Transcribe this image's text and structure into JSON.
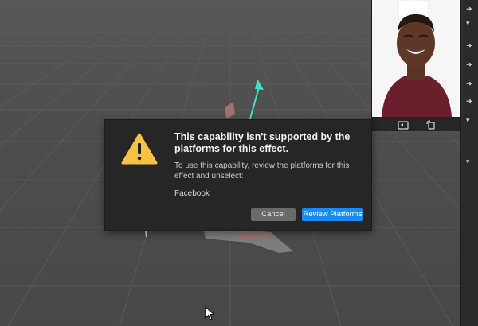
{
  "dialog": {
    "title": "This capability isn't supported by the platforms for this effect.",
    "message": "To use this capability, review the platforms for this effect and unselect:",
    "platform": "Facebook",
    "cancel_label": "Cancel",
    "review_label": "Review Platforms"
  },
  "icons": {
    "warning": "warning-triangle-icon",
    "preview_tool_1": "camera-switch-icon",
    "preview_tool_2": "rotate-device-icon",
    "side_arrows": "chevron-right-icon"
  },
  "colors": {
    "primary_button": "#1a8cf0",
    "warning_icon": "#f5c242",
    "dialog_background": "#262626",
    "gizmo_arrow": "#3fe0c8"
  }
}
